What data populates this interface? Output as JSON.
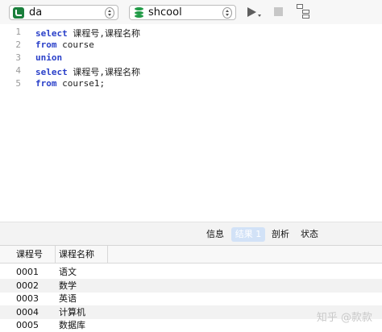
{
  "toolbar": {
    "connection": {
      "value": "da",
      "icon": "connection-icon"
    },
    "database": {
      "value": "shcool",
      "icon": "database-icon"
    },
    "run_icon": "play-icon",
    "stop_icon": "stop-icon",
    "explain_icon": "explain-plan-icon"
  },
  "editor": {
    "lines": [
      {
        "number": "1",
        "keyword": "select",
        "rest": " 课程号,课程名称"
      },
      {
        "number": "2",
        "keyword": "from",
        "rest": " course"
      },
      {
        "number": "3",
        "keyword": "union",
        "rest": ""
      },
      {
        "number": "4",
        "keyword": "select",
        "rest": " 课程号,课程名称"
      },
      {
        "number": "5",
        "keyword": "from",
        "rest": " course1;"
      }
    ]
  },
  "tabs": [
    {
      "label": "信息",
      "active": false
    },
    {
      "label": "结果 1",
      "active": true
    },
    {
      "label": "剖析",
      "active": false
    },
    {
      "label": "状态",
      "active": false
    }
  ],
  "grid": {
    "columns": [
      "课程号",
      "课程名称"
    ],
    "rows": [
      [
        "0001",
        "语文"
      ],
      [
        "0002",
        "数学"
      ],
      [
        "0003",
        "英语"
      ],
      [
        "0004",
        "计算机"
      ],
      [
        "0005",
        "数据库"
      ]
    ]
  },
  "watermark": "知乎 @款款",
  "colors": {
    "keyword": "#2a40c9",
    "active_tab": "#d2e2f7",
    "connection_icon": "#1a7f3c",
    "database_icon": "#1f9a45"
  }
}
